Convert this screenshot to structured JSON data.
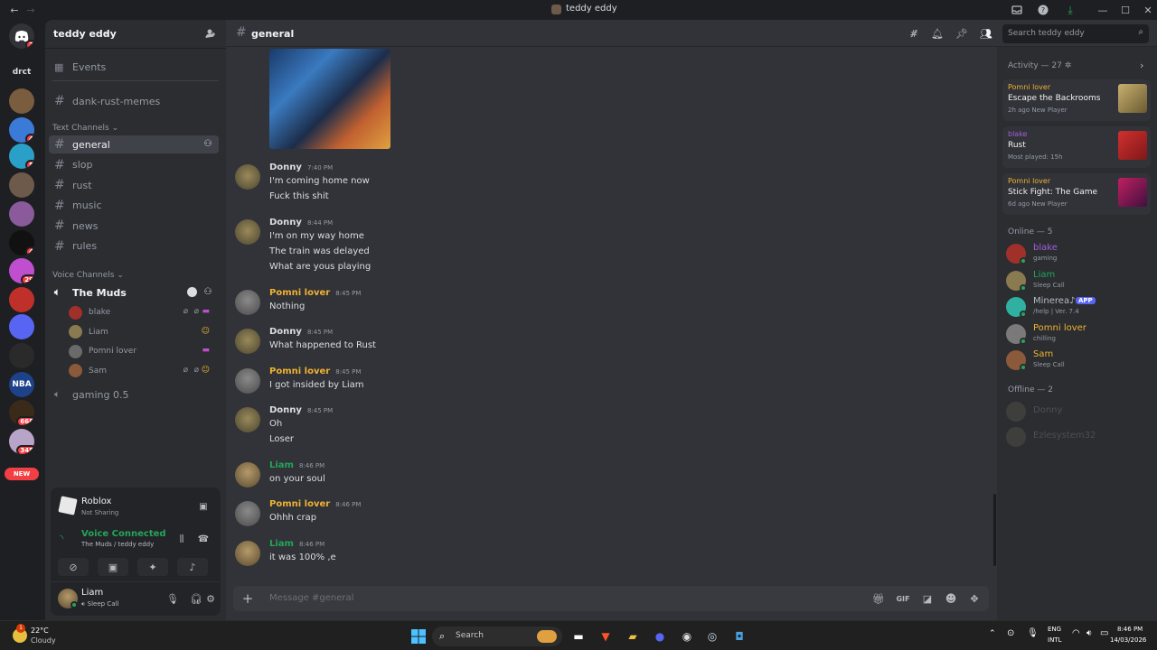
{
  "titlebar": {
    "title": "teddy eddy"
  },
  "guilds": [
    {
      "label": "drct",
      "badge": "",
      "color": "#1e1f22"
    },
    {
      "label": "",
      "badge": "",
      "color": "#7a5c3e"
    },
    {
      "label": "",
      "badge": "4",
      "color": "#3b7bd8"
    },
    {
      "label": "",
      "badge": "5",
      "color": "#2aa0c8"
    },
    {
      "label": "",
      "badge": "",
      "color": "#6d5a4a"
    },
    {
      "label": "",
      "badge": "",
      "color": "#8a5a9a"
    },
    {
      "label": "",
      "badge": "4",
      "color": "#111111"
    },
    {
      "label": "",
      "badge": "29",
      "color": "#c04fd0"
    },
    {
      "label": "",
      "badge": "",
      "color": "#c0302a"
    },
    {
      "label": "",
      "badge": "",
      "color": "#5865f2"
    },
    {
      "label": "",
      "badge": "",
      "color": "#2a2a2a"
    },
    {
      "label": "NBA",
      "badge": "",
      "color": "#1d428a"
    },
    {
      "label": "",
      "badge": "668",
      "color": "#3a2a1a"
    },
    {
      "label": "",
      "badge": "345",
      "color": "#b9a4c9"
    }
  ],
  "guild_home_badge": "2",
  "new_pill": "NEW",
  "server": {
    "name": "teddy eddy"
  },
  "sidebar": {
    "events": "Events",
    "top_channel": "dank-rust-memes",
    "text_category": "Text Channels",
    "text_channels": [
      "general",
      "slop",
      "rust",
      "music",
      "news",
      "rules"
    ],
    "voice_category": "Voice Channels",
    "voice_channel": "The Muds",
    "voice_users": [
      "blake",
      "Liam",
      "Pomni lover",
      "Sam"
    ],
    "voice_channel2": "gaming 0.5"
  },
  "activity_panel": {
    "game": "Roblox",
    "status": "Not Sharing"
  },
  "voice_panel": {
    "status": "Voice Connected",
    "location": "The Muds / teddy eddy"
  },
  "user_panel": {
    "name": "Liam",
    "status": "Sleep Call"
  },
  "chat": {
    "channel": "general",
    "search_placeholder": "Search teddy eddy",
    "input_placeholder": "Message #general",
    "messages": [
      {
        "author": "Donny",
        "time": "7:40 PM",
        "lines": [
          "I'm coming home now",
          "Fuck this shit"
        ]
      },
      {
        "author": "Donny",
        "time": "8:44 PM",
        "lines": [
          "I'm on my way home",
          "The train was delayed",
          "What are yous playing"
        ]
      },
      {
        "author": "Pomni lover",
        "time": "8:45 PM",
        "lines": [
          "Nothing"
        ]
      },
      {
        "author": "Donny",
        "time": "8:45 PM",
        "lines": [
          "What happened to Rust"
        ]
      },
      {
        "author": "Pomni lover",
        "time": "8:45 PM",
        "lines": [
          "I got insided by Liam"
        ]
      },
      {
        "author": "Donny",
        "time": "8:45 PM",
        "lines": [
          "Oh",
          "Loser"
        ]
      },
      {
        "author": "Liam",
        "time": "8:46 PM",
        "lines": [
          "on your soul"
        ]
      },
      {
        "author": "Pomni lover",
        "time": "8:46 PM",
        "lines": [
          "Ohhh crap"
        ]
      },
      {
        "author": "Liam",
        "time": "8:46 PM",
        "lines": [
          "it was 100% ,e"
        ]
      }
    ]
  },
  "members": {
    "activity_header": "Activity — 27",
    "activities": [
      {
        "name": "Pomni lover",
        "game": "Escape the Backrooms",
        "detail": "2h ago  New Player"
      },
      {
        "name": "blake",
        "game": "Rust",
        "detail": "Most played: 15h"
      },
      {
        "name": "Pomni lover",
        "game": "Stick Fight: The Game",
        "detail": "6d ago  New Player"
      }
    ],
    "online_header": "Online — 5",
    "online": [
      {
        "name": "blake",
        "status": "gaming"
      },
      {
        "name": "Liam",
        "status": "Sleep Call"
      },
      {
        "name": "Minerea♪",
        "status": "/help | Ver. 7.4",
        "tag": "APP"
      },
      {
        "name": "Pomni lover",
        "status": "chilling"
      },
      {
        "name": "Sam",
        "status": "Sleep Call"
      }
    ],
    "offline_header": "Offline — 2",
    "offline": [
      "Donny",
      "Ezlesystem32"
    ]
  },
  "taskbar": {
    "temp": "22°C",
    "weather": "Cloudy",
    "search": "Search",
    "lang1": "ENG",
    "lang2": "INTL",
    "time": "8:46 PM",
    "date": "14/03/2026",
    "notif": "1"
  },
  "colors": {
    "donny": "#dbdee1",
    "pomni": "#f0b232",
    "liam": "#23a55a",
    "blake": "#a35fd8"
  }
}
